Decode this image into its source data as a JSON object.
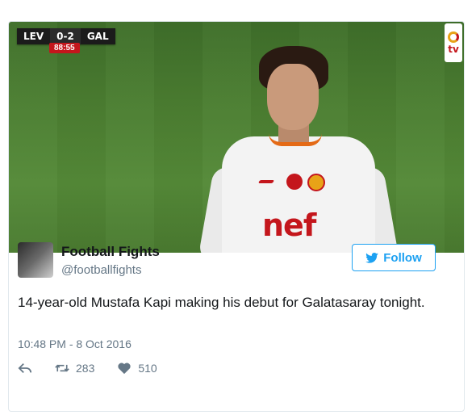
{
  "media": {
    "scorebug": {
      "home": "LEV",
      "score": "0-2",
      "away": "GAL",
      "clock": "88:55"
    },
    "sponsor_text": "nef"
  },
  "tweet": {
    "user_name": "Football Fights",
    "handle": "@footballfights",
    "follow_label": "Follow",
    "text": "14-year-old Mustafa Kapi making his debut for Galatasaray tonight.",
    "timestamp": "10:48 PM - 8 Oct 2016",
    "retweets": "283",
    "likes": "510"
  },
  "colors": {
    "accent": "#1da1f2",
    "muted": "#657786",
    "text": "#14171a"
  },
  "icons": [
    "bird-icon",
    "reply-icon",
    "retweet-icon",
    "heart-icon"
  ]
}
